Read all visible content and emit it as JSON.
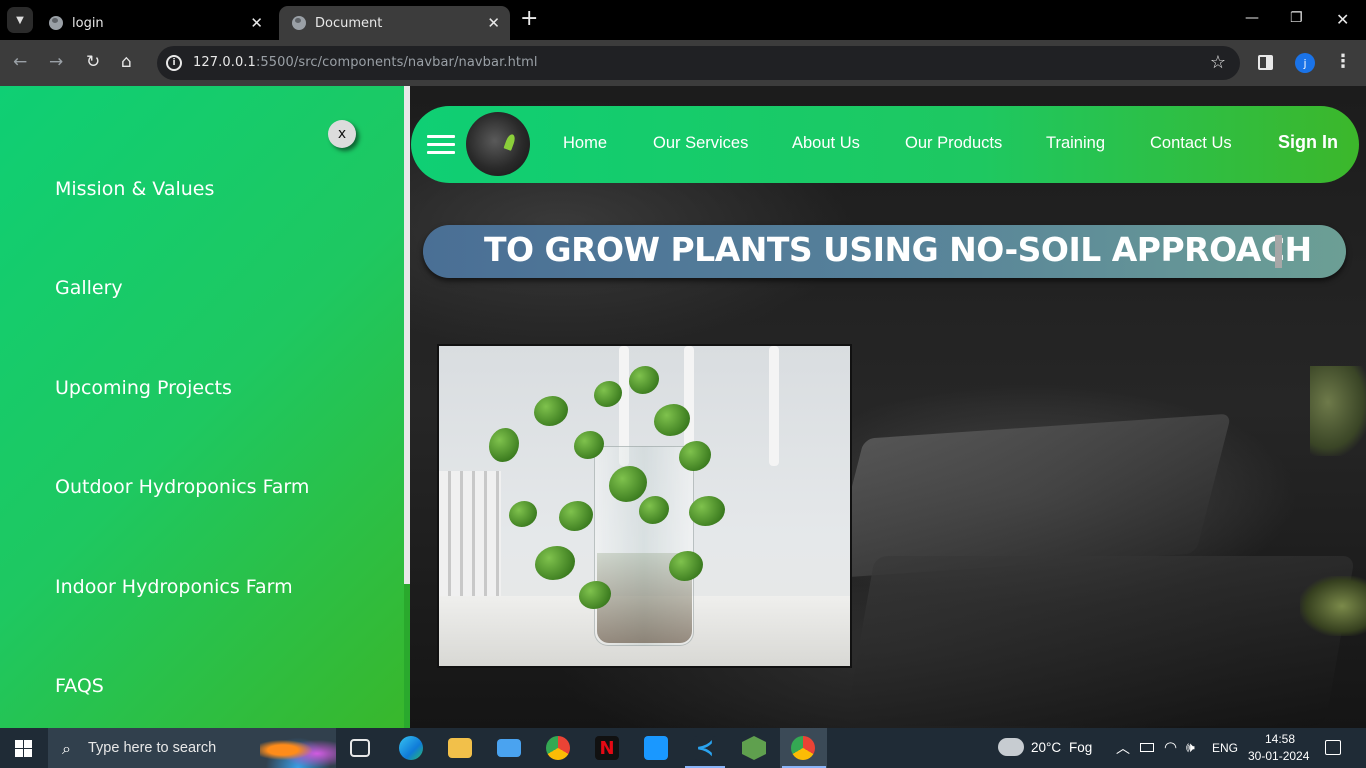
{
  "browser": {
    "tabs": [
      {
        "title": "login",
        "active": false
      },
      {
        "title": "Document",
        "active": true
      }
    ],
    "url_host": "127.0.0.1",
    "url_path": ":5500/src/components/navbar/navbar.html",
    "profile_initial": "j"
  },
  "sidebar": {
    "close_label": "x",
    "items": [
      "Mission & Values",
      "Gallery",
      "Upcoming Projects",
      "Outdoor Hydroponics Farm",
      "Indoor Hydroponics Farm",
      "FAQS"
    ]
  },
  "navbar": {
    "links": [
      "Home",
      "Our Services",
      "About Us",
      "Our Products",
      "Training",
      "Contact Us"
    ],
    "sign_in": "Sign In"
  },
  "hero": {
    "text": "TO GROW PLANTS USING NO-SOIL APPROACH"
  },
  "taskbar": {
    "search_placeholder": "Type here to search",
    "weather_temp": "20°C",
    "weather_desc": "Fog",
    "language": "ENG",
    "time": "14:58",
    "date": "30-01-2024"
  },
  "colors": {
    "sidebar_start": "#0fcf74",
    "sidebar_end": "#39b72b",
    "hero_start": "#4a6f95",
    "hero_end": "#6c9f95"
  }
}
